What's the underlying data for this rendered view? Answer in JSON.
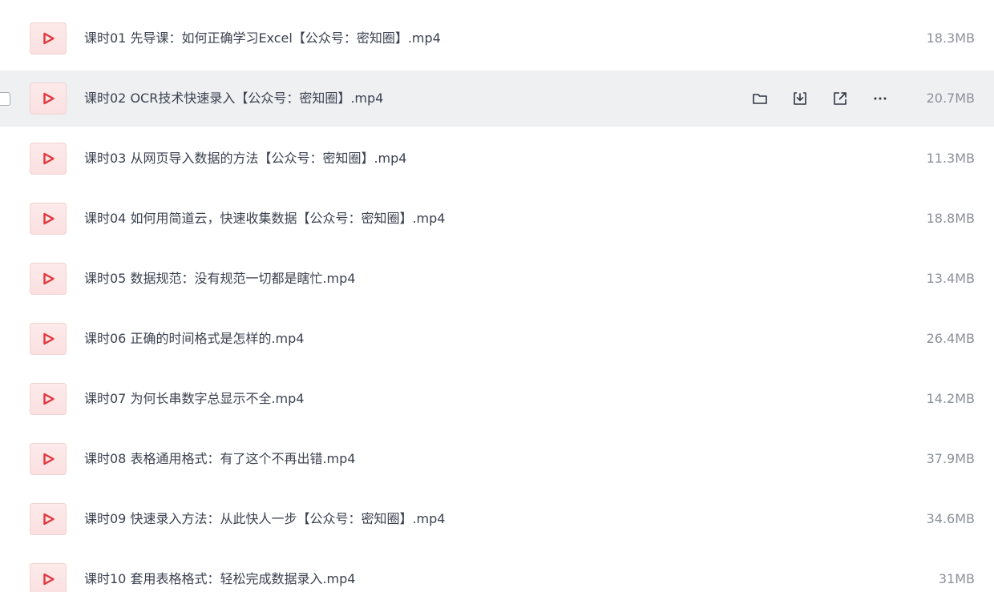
{
  "files": [
    {
      "name": "课时01 先导课：如何正确学习Excel【公众号：密知圈】.mp4",
      "size": "18.3MB",
      "icon": "video-play-icon"
    },
    {
      "name": "课时02 OCR技术快速录入【公众号：密知圈】.mp4",
      "size": "20.7MB",
      "icon": "video-play-icon"
    },
    {
      "name": "课时03 从网页导入数据的方法【公众号：密知圈】.mp4",
      "size": "11.3MB",
      "icon": "video-play-icon"
    },
    {
      "name": "课时04 如何用简道云，快速收集数据【公众号：密知圈】.mp4",
      "size": "18.8MB",
      "icon": "video-play-icon"
    },
    {
      "name": "课时05 数据规范：没有规范一切都是瞎忙.mp4",
      "size": "13.4MB",
      "icon": "video-play-icon"
    },
    {
      "name": "课时06 正确的时间格式是怎样的.mp4",
      "size": "26.4MB",
      "icon": "video-play-icon"
    },
    {
      "name": "课时07 为何长串数字总显示不全.mp4",
      "size": "14.2MB",
      "icon": "video-play-icon"
    },
    {
      "name": "课时08 表格通用格式：有了这个不再出错.mp4",
      "size": "37.9MB",
      "icon": "video-play-icon"
    },
    {
      "name": "课时09 快速录入方法：从此快人一步【公众号：密知圈】.mp4",
      "size": "34.6MB",
      "icon": "video-play-icon"
    },
    {
      "name": "课时10 套用表格格式：轻松完成数据录入.mp4",
      "size": "31MB",
      "icon": "video-play-icon"
    }
  ],
  "hovered_row_actions": [
    "folder-icon",
    "download-icon",
    "share-icon",
    "more-icon"
  ],
  "colors": {
    "accent": "#e0383e",
    "hover_background": "#eef0f2",
    "text": "#3c4150",
    "muted": "#8c9099"
  }
}
